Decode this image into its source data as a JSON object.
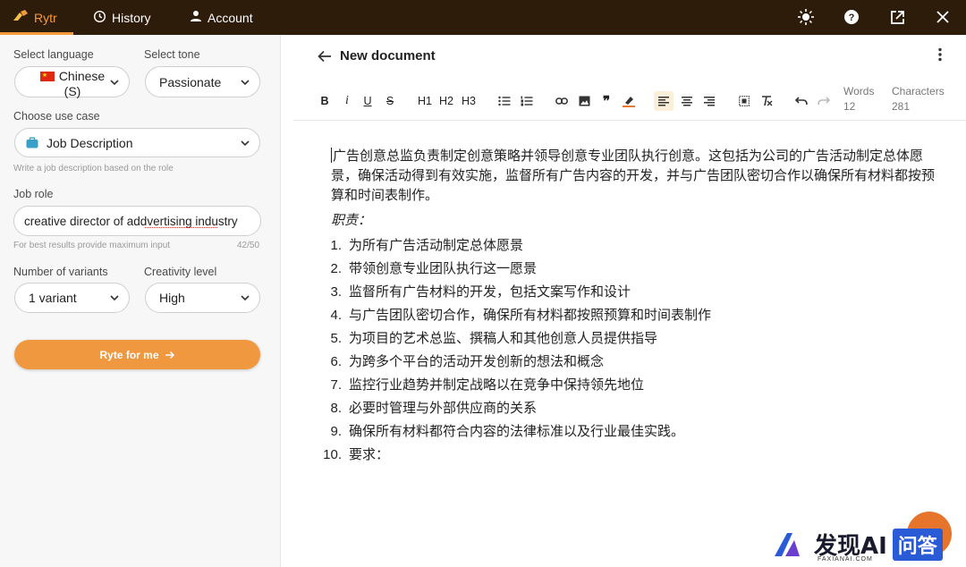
{
  "topbar": {
    "brand": "Rytr",
    "history": "History",
    "account": "Account"
  },
  "sidebar": {
    "language_label": "Select language",
    "language_value_line1": "Chinese",
    "language_value_line2": "(S)",
    "tone_label": "Select tone",
    "tone_value": "Passionate",
    "usecase_label": "Choose use case",
    "usecase_value": "Job Description",
    "usecase_hint": "Write a job description based on the role",
    "jobrole_label": "Job role",
    "jobrole_value": "creative director of addvertising industry",
    "jobrole_hint": "For best results provide maximum input",
    "jobrole_count": "42/50",
    "variants_label": "Number of variants",
    "variants_value": "1 variant",
    "creativity_label": "Creativity level",
    "creativity_value": "High",
    "ryte_button": "Ryte for me"
  },
  "editor": {
    "title": "New document",
    "toolbar": {
      "bold": "B",
      "italic": "i",
      "underline": "U",
      "strike": "S",
      "h1": "H1",
      "h2": "H2",
      "h3": "H3"
    },
    "words_label": "Words",
    "words_value": "12",
    "chars_label": "Characters",
    "chars_value": "281",
    "intro": "广告创意总监负责制定创意策略并领导创意专业团队执行创意。这包括为公司的广告活动制定总体愿景，确保活动得到有效实施，监督所有广告内容的开发，并与广告团队密切合作以确保所有材料都按预算和时间表制作。",
    "duties_heading": "职责：",
    "items": [
      {
        "num": "1.",
        "text": "为所有广告活动制定总体愿景"
      },
      {
        "num": "2.",
        "text": "带领创意专业团队执行这一愿景"
      },
      {
        "num": "3.",
        "text": "监督所有广告材料的开发，包括文案写作和设计"
      },
      {
        "num": "4.",
        "text": "与广告团队密切合作，确保所有材料都按照预算和时间表制作"
      },
      {
        "num": "5.",
        "text": "为项目的艺术总监、撰稿人和其他创意人员提供指导"
      },
      {
        "num": "6.",
        "text": "为跨多个平台的活动开发创新的想法和概念"
      },
      {
        "num": "7.",
        "text": "监控行业趋势并制定战略以在竞争中保持领先地位"
      },
      {
        "num": "8.",
        "text": "必要时管理与外部供应商的关系"
      },
      {
        "num": "9.",
        "text": "确保所有材料都符合内容的法律标准以及行业最佳实践。"
      },
      {
        "num": "10.",
        "text": "要求："
      }
    ]
  },
  "watermark": {
    "text": "发现AI",
    "box": "问答",
    "sub": "FAXIANAI.COM"
  },
  "colors": {
    "topbar_bg": "#2e1c0b",
    "accent": "#f59a3a",
    "button": "#f0983f"
  }
}
